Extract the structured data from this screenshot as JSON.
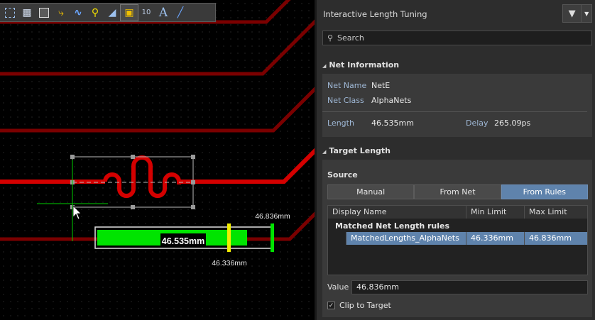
{
  "toolbar": {
    "icons": [
      "select-rect-icon",
      "chart-bar-icon",
      "component-icon",
      "route-icon",
      "tuning-icon",
      "pin-icon",
      "region-icon",
      "diff-pair-icon",
      "dimension-icon",
      "text-icon",
      "line-icon"
    ],
    "text_tool_glyph": "A"
  },
  "canvas": {
    "length_value": "46.535mm",
    "max_label": "46.836mm",
    "min_label": "46.336mm",
    "colors": {
      "trace": "#c80000",
      "trace_dim": "#7a0000",
      "bar": "#00e400",
      "min_marker": "#f2ee00"
    }
  },
  "panel": {
    "title": "Interactive Length Tuning",
    "search_placeholder": "Search",
    "net_info": {
      "heading": "Net Information",
      "net_name_label": "Net Name",
      "net_name": "NetE",
      "net_class_label": "Net Class",
      "net_class": "AlphaNets",
      "length_label": "Length",
      "length": "46.535mm",
      "delay_label": "Delay",
      "delay": "265.09ps"
    },
    "target": {
      "heading": "Target Length",
      "source_label": "Source",
      "tabs": [
        {
          "label": "Manual",
          "active": false
        },
        {
          "label": "From Net",
          "active": false
        },
        {
          "label": "From Rules",
          "active": true
        }
      ],
      "columns": [
        "Display Name",
        "Min Limit",
        "Max Limit"
      ],
      "group_label": "Matched Net Length rules",
      "rows": [
        {
          "name": "MatchedLengths_AlphaNets",
          "min": "46.336mm",
          "max": "46.836mm",
          "selected": true
        }
      ],
      "value_label": "Value",
      "value": "46.836mm",
      "clip_label": "Clip to Target",
      "clip_checked": true
    },
    "accent": "#5f83ac"
  }
}
